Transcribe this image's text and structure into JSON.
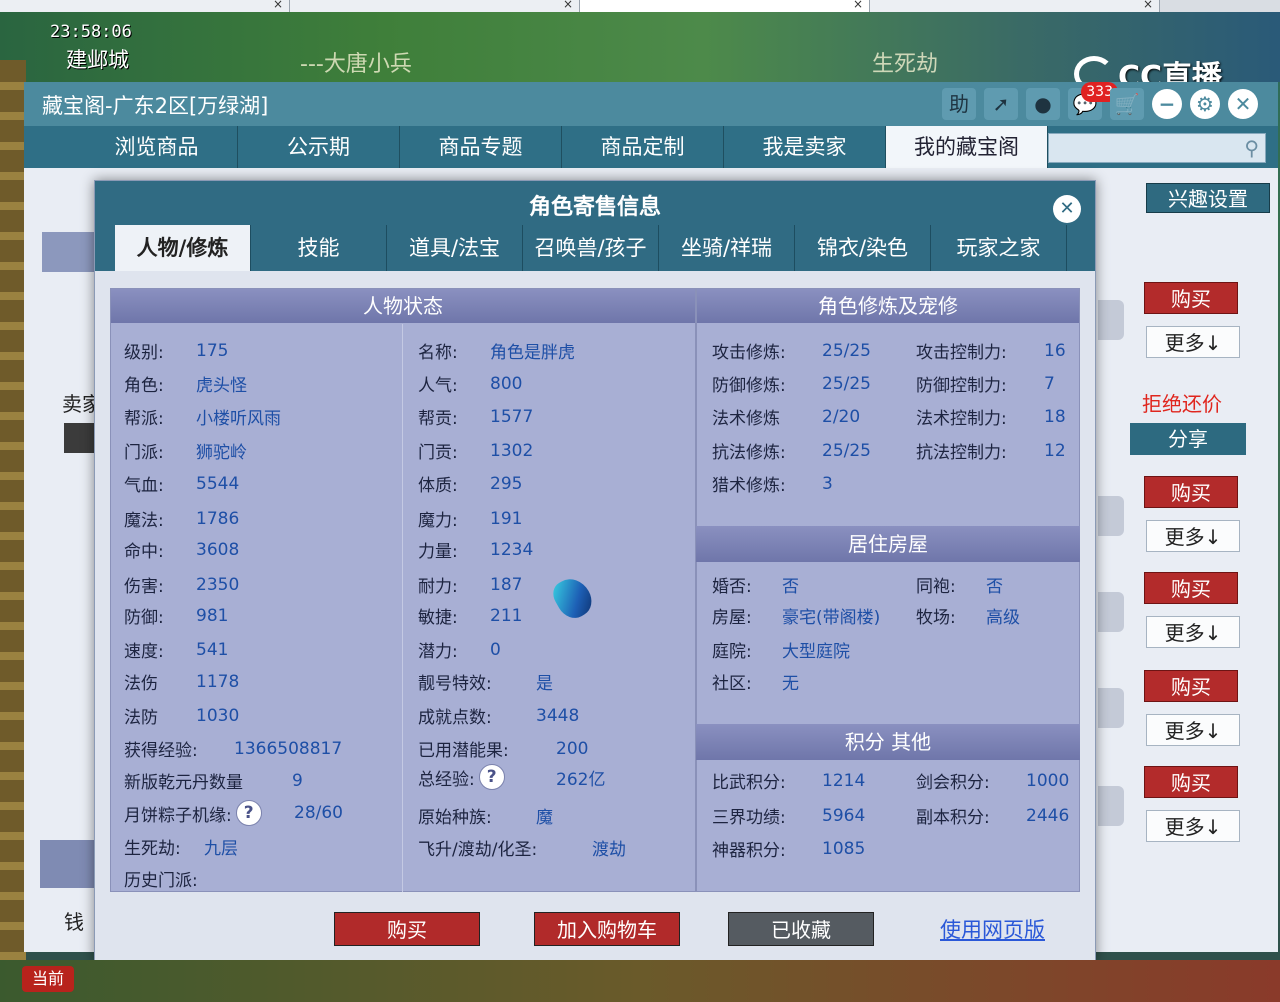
{
  "hud": {
    "clock": "23:58:06",
    "city": "建邺城",
    "banner": "---大唐小兵",
    "banner_right": "生死劫",
    "stream_logo": "CC直播"
  },
  "main_window": {
    "title": "藏宝阁-广东2区[万绿湖]",
    "toolbar": {
      "help": "助",
      "badge_count": "333"
    },
    "nav": [
      "浏览商品",
      "公示期",
      "商品专题",
      "商品定制",
      "我是卖家",
      "我的藏宝阁"
    ],
    "search_placeholder": "",
    "interest_settings": "兴趣设置",
    "buy_label": "购买",
    "more_label": "更多↓",
    "refuse_bargain": "拒绝还价",
    "share": "分享",
    "seller_label": "卖家",
    "money_label": "钱"
  },
  "dialog": {
    "title": "角色寄售信息",
    "tabs": [
      "人物/修炼",
      "技能",
      "道具/法宝",
      "召唤兽/孩子",
      "坐骑/祥瑞",
      "锦衣/染色",
      "玩家之家"
    ],
    "status_panel": {
      "title": "人物状态",
      "left_col": [
        {
          "k": "级别:",
          "v": "175"
        },
        {
          "k": "角色:",
          "v": "虎头怪"
        },
        {
          "k": "帮派:",
          "v": "小楼听风雨"
        },
        {
          "k": "门派:",
          "v": "狮驼岭"
        },
        {
          "k": "气血:",
          "v": "5544"
        },
        {
          "k": "魔法:",
          "v": "1786"
        },
        {
          "k": "命中:",
          "v": "3608"
        },
        {
          "k": "伤害:",
          "v": "2350"
        },
        {
          "k": "防御:",
          "v": "981"
        },
        {
          "k": "速度:",
          "v": "541"
        },
        {
          "k": "法伤",
          "v": "1178"
        },
        {
          "k": "法防",
          "v": "1030"
        },
        {
          "k": "获得经验:",
          "v": "1366508817"
        },
        {
          "k": "新版乾元丹数量",
          "v": "9"
        },
        {
          "k": "月饼粽子机缘:",
          "v": "28/60"
        },
        {
          "k": "生死劫:",
          "v": "九层"
        },
        {
          "k": "历史门派:",
          "v": ""
        }
      ],
      "right_col": [
        {
          "k": "名称:",
          "v": "角色是胖虎"
        },
        {
          "k": "人气:",
          "v": "800"
        },
        {
          "k": "帮贡:",
          "v": "1577"
        },
        {
          "k": "门贡:",
          "v": "1302"
        },
        {
          "k": "体质:",
          "v": "295"
        },
        {
          "k": "魔力:",
          "v": "191"
        },
        {
          "k": "力量:",
          "v": "1234"
        },
        {
          "k": "耐力:",
          "v": "187"
        },
        {
          "k": "敏捷:",
          "v": "211"
        },
        {
          "k": "潜力:",
          "v": "0"
        },
        {
          "k": "靓号特效:",
          "v": "是"
        },
        {
          "k": "成就点数:",
          "v": "3448"
        },
        {
          "k": "已用潜能果:",
          "v": "200"
        },
        {
          "k": "总经验:",
          "v": "262亿"
        },
        {
          "k": "原始种族:",
          "v": "魔"
        },
        {
          "k": "飞升/渡劫/化圣:",
          "v": "渡劫"
        }
      ]
    },
    "cultivation_panel": {
      "title": "角色修炼及宠修",
      "left_col": [
        {
          "k": "攻击修炼:",
          "v": "25/25"
        },
        {
          "k": "防御修炼:",
          "v": "25/25"
        },
        {
          "k": "法术修炼",
          "v": "2/20"
        },
        {
          "k": "抗法修炼:",
          "v": "25/25"
        },
        {
          "k": "猎术修炼:",
          "v": "3"
        }
      ],
      "right_col": [
        {
          "k": "攻击控制力:",
          "v": "16"
        },
        {
          "k": "防御控制力:",
          "v": "7"
        },
        {
          "k": "法术控制力:",
          "v": "18"
        },
        {
          "k": "抗法控制力:",
          "v": "12"
        }
      ]
    },
    "house_panel": {
      "title": "居住房屋",
      "rows": [
        {
          "k": "婚否:",
          "v": "否"
        },
        {
          "k": "房屋:",
          "v": "豪宅(带阁楼)"
        },
        {
          "k": "庭院:",
          "v": "大型庭院"
        },
        {
          "k": "社区:",
          "v": "无"
        }
      ],
      "right": [
        {
          "k": "同袍:",
          "v": "否"
        },
        {
          "k": "牧场:",
          "v": "高级"
        }
      ]
    },
    "points_panel": {
      "title": "积分 其他",
      "left_col": [
        {
          "k": "比武积分:",
          "v": "1214"
        },
        {
          "k": "三界功绩:",
          "v": "5964"
        },
        {
          "k": "神器积分:",
          "v": "1085"
        }
      ],
      "right_col": [
        {
          "k": "剑会积分:",
          "v": "1000"
        },
        {
          "k": "副本积分:",
          "v": "2446"
        }
      ]
    },
    "buttons": {
      "buy": "购买",
      "add_cart": "加入购物车",
      "favorited": "已收藏",
      "web_version": "使用网页版"
    },
    "help_mark": "?"
  },
  "bottom": {
    "current_channel": "当前"
  }
}
